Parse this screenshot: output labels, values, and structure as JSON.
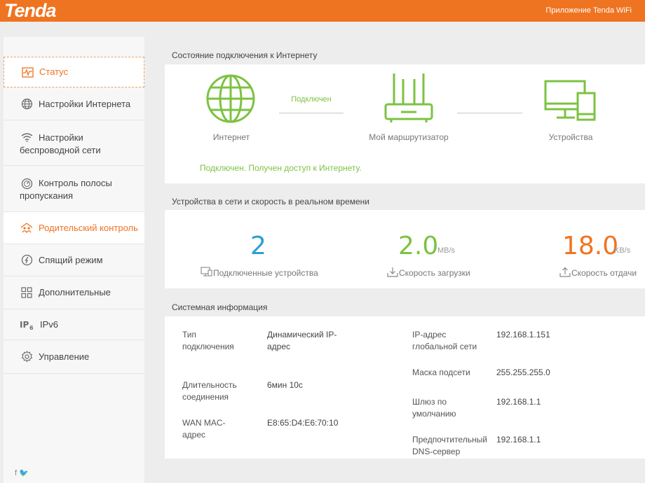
{
  "header": {
    "brand": "Tenda",
    "app_link": "Приложение Tenda WiFi",
    "accent": "#ef7421"
  },
  "sidebar": {
    "items": [
      {
        "label": "Статус",
        "icon": "status-chart-icon",
        "state": "active"
      },
      {
        "label": "Настройки Интернета",
        "icon": "globe-icon"
      },
      {
        "label": "Настройки беспроводной сети",
        "icon": "wifi-icon"
      },
      {
        "label": "Контроль полосы пропускания",
        "icon": "gauge-icon"
      },
      {
        "label": "Родительский контроль",
        "icon": "family-icon",
        "state": "hover"
      },
      {
        "label": "Спящий режим",
        "icon": "sleep-icon"
      },
      {
        "label": "Дополнительные",
        "icon": "grid-icon"
      },
      {
        "label": "IPv6",
        "icon": "ipv6-icon"
      },
      {
        "label": "Управление",
        "icon": "gear-icon"
      }
    ],
    "social": "f 🐦"
  },
  "connection": {
    "title": "Состояние подключения к Интернету",
    "internet_label": "Интернет",
    "router_label": "Мой маршрутизатор",
    "devices_label": "Устройства",
    "link_state": "Подключен",
    "message": "Подключен. Получен доступ к Интернету.",
    "ok_color": "#7cc242"
  },
  "realtime": {
    "title": "Устройства в сети и скорость в реальном времени",
    "devices_count": "2",
    "devices_label": "Подключенные устройства",
    "download_value": "2.0",
    "download_unit": "MB/s",
    "download_label": "Скорость загрузки",
    "upload_value": "18.0",
    "upload_unit": "KB/s",
    "upload_label": "Скорость отдачи",
    "colors": {
      "count": "#2a9fd6",
      "download": "#7cc242",
      "upload": "#ef7421"
    }
  },
  "system": {
    "title": "Системная информация",
    "left": [
      {
        "key": "Тип подключения",
        "value": "Динамический IP-адрес"
      },
      {
        "key": "Длительность соединения",
        "value": "6мин 10с"
      },
      {
        "key": "WAN MAC-адрес",
        "value": "E8:65:D4:E6:70:10"
      }
    ],
    "right": [
      {
        "key": "IP-адрес глобальной сети",
        "value": "192.168.1.151"
      },
      {
        "key": "Маска подсети",
        "value": "255.255.255.0"
      },
      {
        "key": "Шлюз по умолчанию",
        "value": "192.168.1.1"
      },
      {
        "key": "Предпочтительный DNS-сервер",
        "value": "192.168.1.1"
      }
    ]
  }
}
